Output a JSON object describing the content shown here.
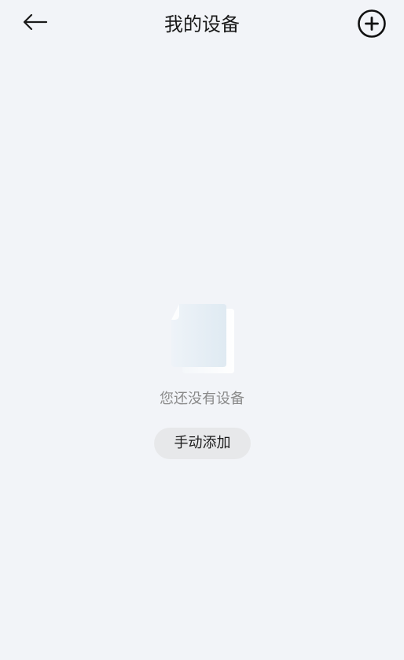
{
  "header": {
    "title": "我的设备",
    "back_icon": "arrow-left-icon",
    "add_icon": "plus-circle-icon"
  },
  "empty_state": {
    "illustration_icon": "empty-document-icon",
    "message": "您还没有设备",
    "action_label": "手动添加"
  },
  "colors": {
    "background": "#f2f4f8",
    "title_text": "#191919",
    "message_text": "#8a8a8a",
    "button_bg": "#e7e8ea"
  }
}
